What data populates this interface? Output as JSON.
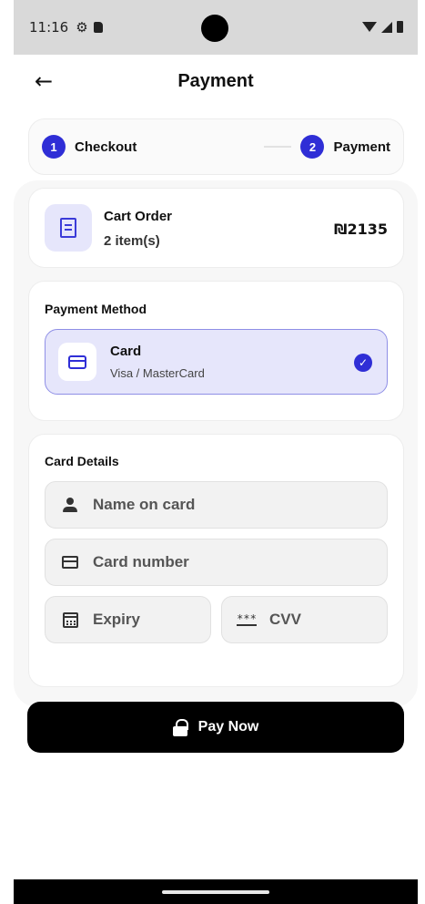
{
  "status_bar": {
    "time": "11:16",
    "icons": [
      "gear-icon",
      "sd-card-icon",
      "wifi-icon",
      "signal-icon",
      "battery-icon"
    ]
  },
  "header": {
    "back_icon": "arrow-left-icon",
    "title": "Payment"
  },
  "stepper": {
    "steps": [
      {
        "number": "1",
        "label": "Checkout"
      },
      {
        "number": "2",
        "label": "Payment"
      }
    ],
    "accent_color": "#2f2ed6"
  },
  "cart_order": {
    "icon": "receipt-icon",
    "title": "Cart Order",
    "items": "2 item(s)",
    "price": "₪2135"
  },
  "payment_method": {
    "title": "Payment Method",
    "option": {
      "icon": "credit-card-icon",
      "label": "Card",
      "sublabel": "Visa / MasterCard",
      "selected": true
    }
  },
  "card_details": {
    "title": "Card Details",
    "fields": {
      "name": {
        "icon": "person-icon",
        "placeholder": "Name on card"
      },
      "number": {
        "icon": "credit-card-icon",
        "placeholder": "Card number"
      },
      "expiry": {
        "icon": "calendar-icon",
        "placeholder": "Expiry"
      },
      "cvv": {
        "icon": "password-icon",
        "placeholder": "CVV"
      }
    }
  },
  "pay_button": {
    "icon": "lock-icon",
    "label": "Pay Now"
  }
}
